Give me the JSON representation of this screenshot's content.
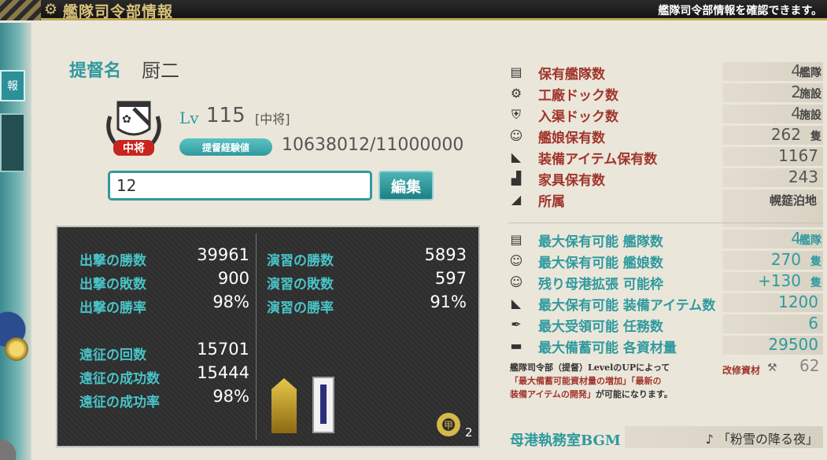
{
  "header": {
    "title": "艦隊司令部情報",
    "subtitle": "艦隊司令部情報を確認できます。",
    "icon": "gear-icon"
  },
  "sidebar": {
    "tab_label": "報"
  },
  "profile": {
    "name_label": "提督名",
    "name": "厨二",
    "lv_label": "Lv",
    "level": "115",
    "rank": "[中将]",
    "rank_badge": "中将",
    "exp_label": "提督経験値",
    "exp": "10638012/11000000",
    "comment": "12",
    "edit_label": "編集"
  },
  "records": {
    "sortie": [
      {
        "label": "出撃の勝数",
        "value": "39961"
      },
      {
        "label": "出撃の敗数",
        "value": "900"
      },
      {
        "label": "出撃の勝率",
        "value": "98%"
      }
    ],
    "exercise": [
      {
        "label": "演習の勝数",
        "value": "5893"
      },
      {
        "label": "演習の敗数",
        "value": "597"
      },
      {
        "label": "演習の勝率",
        "value": "91%"
      }
    ],
    "expedition": [
      {
        "label": "遠征の回数",
        "value": "15701"
      },
      {
        "label": "遠征の成功数",
        "value": "15444"
      },
      {
        "label": "遠征の成功率",
        "value": "98%"
      }
    ],
    "koh_medal": "甲",
    "koh_count": "2"
  },
  "stats": [
    {
      "icon": "fleet-icon",
      "glyph": "▤",
      "label": "保有艦隊数",
      "value": "4",
      "unit": "艦隊"
    },
    {
      "icon": "gear-icon",
      "glyph": "⚙",
      "label": "工廠ドック数",
      "value": "2",
      "unit": "施設"
    },
    {
      "icon": "shield-icon",
      "glyph": "⛨",
      "label": "入渠ドック数",
      "value": "4",
      "unit": "施設"
    },
    {
      "icon": "girl-icon",
      "glyph": "☺",
      "label": "艦娘保有数",
      "value": "262",
      "unit": "隻"
    },
    {
      "icon": "equipment-icon",
      "glyph": "◣",
      "label": "装備アイテム保有数",
      "value": "1167",
      "unit": ""
    },
    {
      "icon": "furniture-icon",
      "glyph": "▟",
      "label": "家具保有数",
      "value": "243",
      "unit": ""
    },
    {
      "icon": "base-icon",
      "glyph": "◢",
      "label": "所属",
      "value": "",
      "unit": "",
      "affiliation": "幌筵泊地"
    }
  ],
  "max_stats": [
    {
      "icon": "fleet-icon",
      "glyph": "▤",
      "label": "最大保有可能 艦隊数",
      "value": "4",
      "unit": "艦隊"
    },
    {
      "icon": "girl-icon",
      "glyph": "☺",
      "label": "最大保有可能 艦娘数",
      "value": "270",
      "unit": "隻"
    },
    {
      "icon": "girl-icon",
      "glyph": "☺",
      "label": "残り母港拡張 可能枠",
      "value": "+130",
      "unit": "隻"
    },
    {
      "icon": "equipment-icon",
      "glyph": "◣",
      "label": "最大保有可能 装備アイテム数",
      "value": "1200",
      "unit": ""
    },
    {
      "icon": "quill-icon",
      "glyph": "✒",
      "label": "最大受領可能 任務数",
      "value": "6",
      "unit": ""
    },
    {
      "icon": "storage-icon",
      "glyph": "▬",
      "label": "最大備蓄可能 各資材量",
      "value": "29500",
      "unit": ""
    }
  ],
  "note": {
    "line1": "艦隊司令部（提督）LevelのUPによって",
    "line2": "「最大備蓄可能資材量の増加」「最新の",
    "line3": "装備アイテムの開発」",
    "line3b": "が可能になります。"
  },
  "improvement": {
    "label": "改修資材",
    "icon": "screw-icon",
    "value": "62"
  },
  "bgm": {
    "label": "母港執務室BGM",
    "note_icon": "♪",
    "value": "「粉雪の降る夜」"
  },
  "colors": {
    "teal": "#2f9a9e",
    "red_label": "#a0352c",
    "gold": "#d9c27a"
  }
}
